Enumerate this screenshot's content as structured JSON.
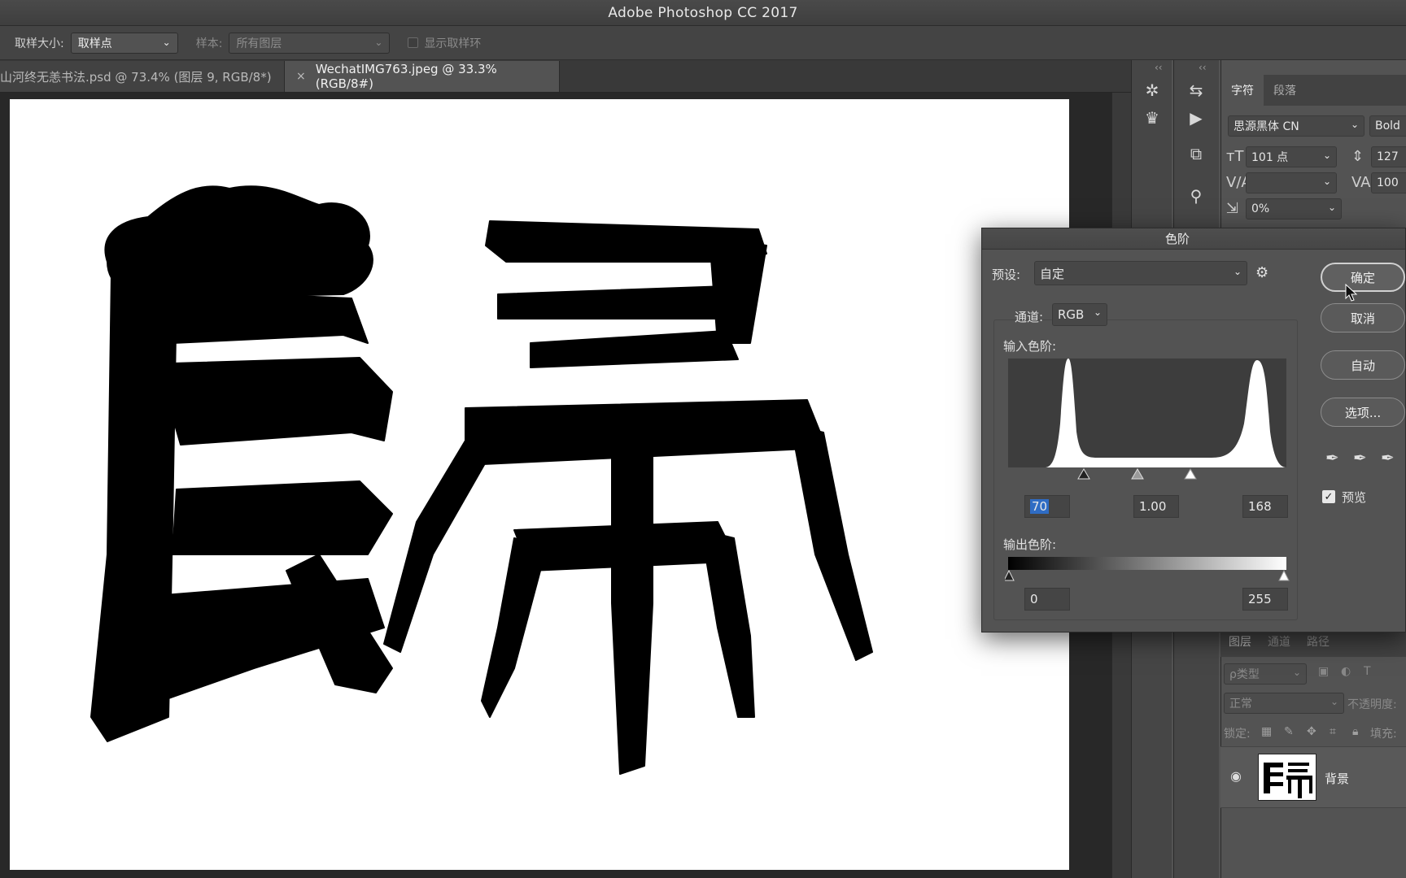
{
  "app": {
    "title": "Adobe Photoshop CC 2017"
  },
  "options_bar": {
    "sample_size_label": "取样大小:",
    "sample_size_value": "取样点",
    "sample_label": "样本:",
    "sample_value": "所有图层",
    "show_ring_label": "显示取样环"
  },
  "tabs": [
    {
      "label": "山河终无恙书法.psd @ 73.4% (图层 9, RGB/8*)"
    },
    {
      "close": "×",
      "label": "WechatIMG763.jpeg @ 33.3%(RGB/8#)"
    }
  ],
  "dock": {
    "collapse_left": "‹‹",
    "collapse_right": "‹‹"
  },
  "character_panel": {
    "tab_character": "字符",
    "tab_paragraph": "段落",
    "font_family": "思源黑体 CN",
    "font_style": "Bold",
    "font_size": "101 点",
    "leading": "127",
    "tracking": "100",
    "kerning": "",
    "scale": "0%"
  },
  "levels_dialog": {
    "title": "色阶",
    "preset_label": "预设:",
    "preset_value": "自定",
    "channel_label": "通道:",
    "channel_value": "RGB",
    "input_levels_label": "输入色阶:",
    "input_black": "70",
    "input_gamma": "1.00",
    "input_white": "168",
    "output_levels_label": "输出色阶:",
    "output_black": "0",
    "output_white": "255",
    "ok_label": "确定",
    "cancel_label": "取消",
    "auto_label": "自动",
    "options_label": "选项...",
    "preview_label": "预览",
    "preview_checked": true
  },
  "layers_panel": {
    "tab_layers": "图层",
    "tab_channels": "通道",
    "tab_paths": "路径",
    "filter_kind": "ρ类型",
    "blend_mode": "正常",
    "opacity_label": "不透明度:",
    "lock_label": "锁定:",
    "fill_label": "填充:",
    "layer_name": "背景"
  },
  "colors": {
    "ui_background": "#535353",
    "canvas": "#ffffff",
    "ink": "#000000"
  }
}
